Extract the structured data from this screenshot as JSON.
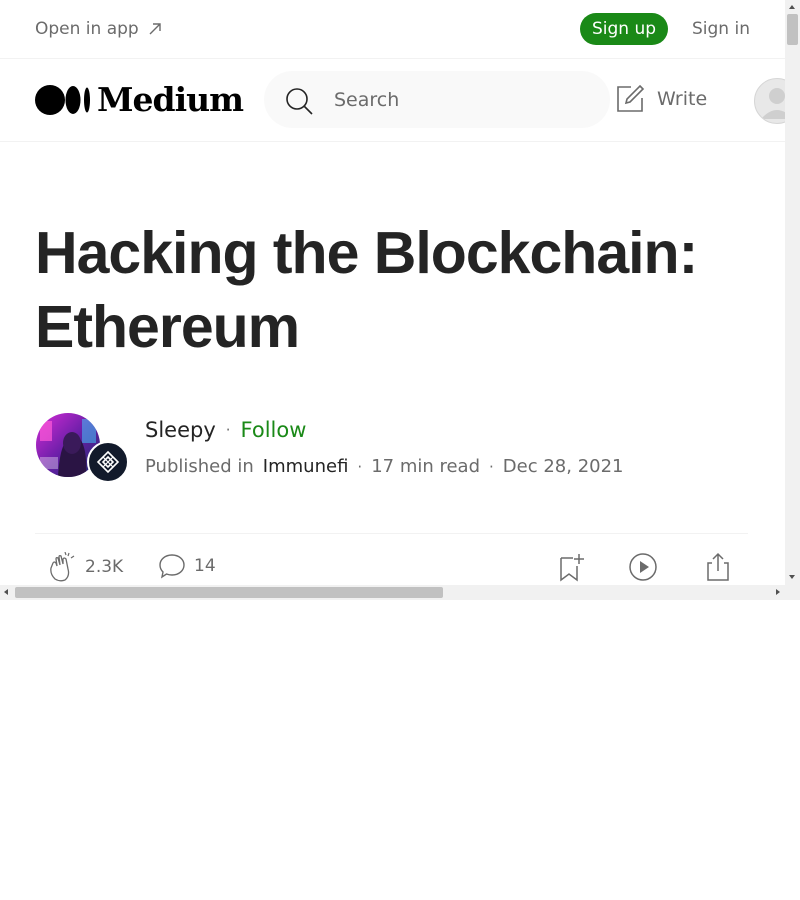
{
  "topbar": {
    "open_in_app": "Open in app",
    "signup": "Sign up",
    "signin": "Sign in"
  },
  "header": {
    "logo_text": "Medium",
    "search_placeholder": "Search",
    "write": "Write"
  },
  "article": {
    "title_line1": "Hacking the Blockchain:",
    "title_line2": "Ethereum",
    "author": "Sleepy",
    "follow": "Follow",
    "published_in_label": "Published in",
    "publication": "Immunefi",
    "read_time": "17 min read",
    "date": "Dec 28, 2021",
    "claps": "2.3K",
    "responses": "14",
    "separator": "·"
  },
  "colors": {
    "accent_green": "#1a8917",
    "text_primary": "#242424",
    "text_secondary": "#6b6b6b"
  },
  "icons": [
    "arrow-up-right-icon",
    "search-icon",
    "write-icon",
    "clap-icon",
    "response-icon",
    "bookmark-add-icon",
    "play-icon",
    "share-icon"
  ]
}
